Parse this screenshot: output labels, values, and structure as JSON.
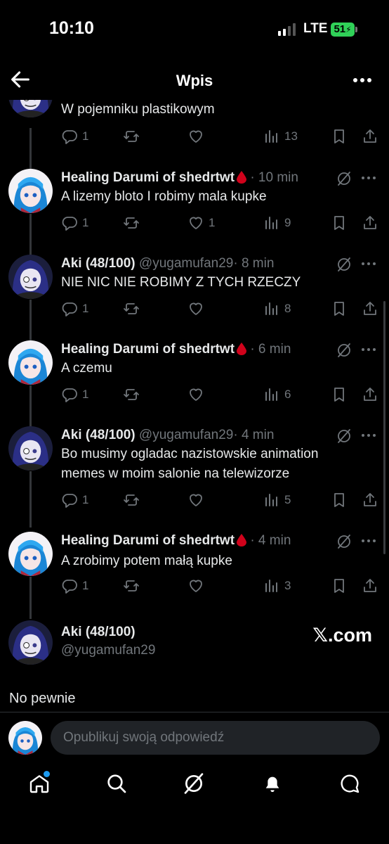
{
  "status_bar": {
    "time": "10:10",
    "network": "LTE",
    "battery": "51"
  },
  "header": {
    "title": "Wpis"
  },
  "tweets": [
    {
      "text": "W pojemniku plastikowym",
      "replies": "1",
      "retweets": "",
      "likes": "",
      "views": "13"
    },
    {
      "name": "Healing Darumi of shedrtwt",
      "handle": "",
      "time": "· 10 min",
      "text": "A lizemy bloto I robimy mala kupke",
      "replies": "1",
      "retweets": "",
      "likes": "1",
      "views": "9",
      "emoji": "blood-drop"
    },
    {
      "name": "Aki (48/100)",
      "handle": "@yugamufan29",
      "time": "· 8 min",
      "text": "NIE NIC NIE ROBIMY Z TYCH RZECZY",
      "replies": "1",
      "retweets": "",
      "likes": "",
      "views": "8"
    },
    {
      "name": "Healing Darumi of shedrtwt",
      "handle": "",
      "time": "· 6 min",
      "text": "A czemu",
      "replies": "1",
      "retweets": "",
      "likes": "",
      "views": "6",
      "emoji": "blood-drop"
    },
    {
      "name": "Aki (48/100)",
      "handle": "@yugamufan29",
      "time": "· 4 min",
      "text": "Bo musimy ogladac nazistowskie animation memes w moim salonie na telewizorze",
      "replies": "1",
      "retweets": "",
      "likes": "",
      "views": "5"
    },
    {
      "name": "Healing Darumi of shedrtwt",
      "handle": "",
      "time": "· 4 min",
      "text": "A zrobimy potem małą kupke",
      "replies": "1",
      "retweets": "",
      "likes": "",
      "views": "3",
      "emoji": "blood-drop"
    }
  ],
  "focused": {
    "name": "Aki (48/100)",
    "handle": "@yugamufan29",
    "watermark": "𝕏.com",
    "text": "No pewnie"
  },
  "reply_bar": {
    "placeholder": "Opublikuj swoją odpowiedź"
  },
  "tabs": [
    "home-icon",
    "search-icon",
    "grok-icon",
    "notifications-icon",
    "messages-icon"
  ],
  "colors": {
    "background": "#000000",
    "text": "#e7e9ea",
    "muted": "#71767b",
    "accent": "#1d9bf0",
    "blood": "#d0021b",
    "battery": "#30d158"
  }
}
